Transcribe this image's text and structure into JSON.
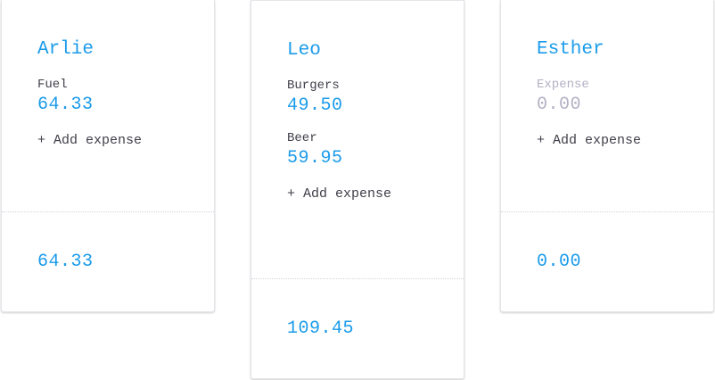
{
  "people": [
    {
      "name": "Arlie",
      "expenses": [
        {
          "label": "Fuel",
          "amount": "64.33"
        }
      ],
      "add_label": "+ Add expense",
      "total": "64.33"
    },
    {
      "name": "Leo",
      "expenses": [
        {
          "label": "Burgers",
          "amount": "49.50"
        },
        {
          "label": "Beer",
          "amount": "59.95"
        }
      ],
      "add_label": "+ Add expense",
      "total": "109.45"
    },
    {
      "name": "Esther",
      "new_expense": {
        "label_placeholder": "Expense",
        "amount_placeholder": "0.00"
      },
      "add_label": "+ Add expense",
      "total": "0.00"
    }
  ],
  "colors": {
    "accent": "#1a9bea",
    "text": "#3f3f4a",
    "placeholder": "#b3b0c4"
  }
}
